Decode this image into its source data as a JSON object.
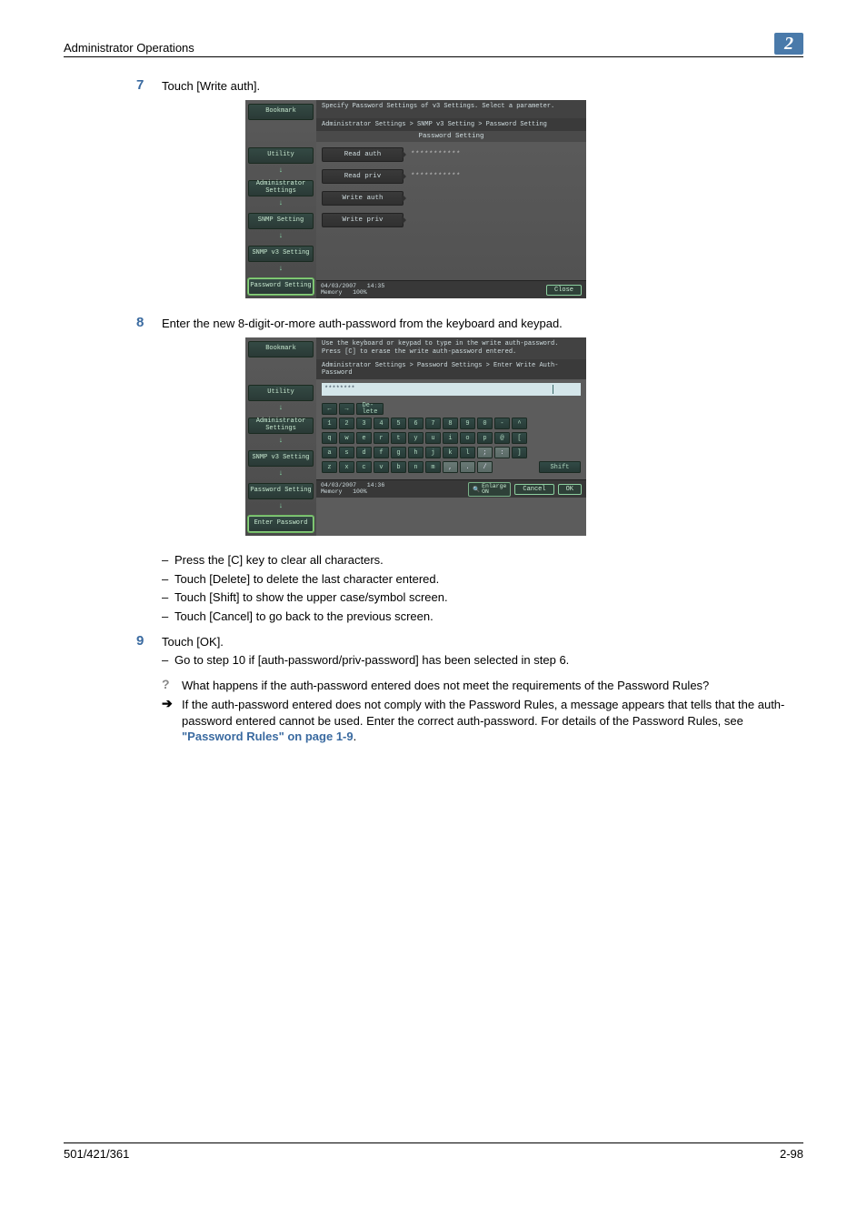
{
  "header": {
    "title": "Administrator Operations",
    "chapter": "2"
  },
  "steps": {
    "s7": {
      "num": "7",
      "text": "Touch [Write auth]."
    },
    "s8": {
      "num": "8",
      "text": "Enter the new 8-digit-or-more auth-password from the keyboard and keypad."
    },
    "s9": {
      "num": "9",
      "text": "Touch [OK]."
    }
  },
  "bullets_s8": [
    "Press the [C] key to clear all characters.",
    "Touch [Delete] to delete the last character entered.",
    "Touch [Shift] to show the upper case/symbol screen.",
    "Touch [Cancel] to go back to the previous screen."
  ],
  "bullets_s9": [
    "Go to step 10 if [auth-password/priv-password] has been selected in step 6."
  ],
  "qa": {
    "q": "What happens if the auth-password entered does not meet the requirements of the Password Rules?",
    "a_pre": "If the auth-password entered does not comply with the Password Rules, a message appears that tells that the auth-password entered cannot be used. Enter the correct auth-password. For details of the Password Rules, see ",
    "a_link": "\"Password Rules\" on page 1-9",
    "a_post": "."
  },
  "screen1": {
    "side": {
      "bookmark": "Bookmark",
      "utility": "Utility",
      "admin": "Administrator\nSettings",
      "snmp": "SNMP Setting",
      "snmpv3": "SNMP v3 Setting",
      "pwd": "Password Setting"
    },
    "top": "Specify Password Settings of v3 Settings. Select a parameter.",
    "crumb": "Administrator Settings > SNMP v3 Setting > Password Setting",
    "sub": "Password Setting",
    "rows": {
      "read_auth": "Read auth",
      "read_priv": "Read priv",
      "write_auth": "Write auth",
      "write_priv": "Write priv",
      "mask": "***********"
    },
    "foot": {
      "date": "04/03/2007",
      "time": "14:35",
      "mem": "Memory",
      "pct": "100%",
      "close": "Close"
    }
  },
  "screen2": {
    "side": {
      "bookmark": "Bookmark",
      "utility": "Utility",
      "admin": "Administrator\nSettings",
      "snmpv3": "SNMP v3 Setting",
      "pwd": "Password Setting",
      "enter": "Enter Password"
    },
    "top": "Use the keyboard or keypad to type in the write auth-password.\nPress [C] to erase the write auth-password entered.",
    "crumb": "Administrator Settings > Password Settings > Enter Write Auth-Password",
    "value": "********",
    "keys": {
      "arrow_l": "←",
      "arrow_r": "→",
      "del": "De-\nlete",
      "r1": [
        "1",
        "2",
        "3",
        "4",
        "5",
        "6",
        "7",
        "8",
        "9",
        "0",
        "-",
        "^"
      ],
      "r2": [
        "q",
        "w",
        "e",
        "r",
        "t",
        "y",
        "u",
        "i",
        "o",
        "p",
        "@",
        "["
      ],
      "r3": [
        "a",
        "s",
        "d",
        "f",
        "g",
        "h",
        "j",
        "k",
        "l",
        ";",
        ":",
        "]"
      ],
      "r4": [
        "z",
        "x",
        "c",
        "v",
        "b",
        "n",
        "m",
        ",",
        ".",
        "/"
      ],
      "shift": "Shift"
    },
    "foot": {
      "date": "04/03/2007",
      "time": "14:36",
      "mem": "Memory",
      "pct": "100%",
      "enlarge": "Enlarge\nON",
      "cancel": "Cancel",
      "ok": "OK"
    }
  },
  "footer": {
    "left": "501/421/361",
    "right": "2-98"
  }
}
